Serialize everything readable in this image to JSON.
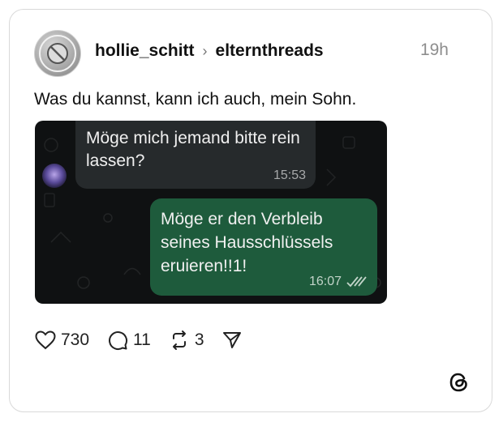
{
  "post": {
    "username": "hollie_schitt",
    "community": "elternthreads",
    "time": "19h",
    "caption": "Was du kannst, kann ich auch, mein Sohn."
  },
  "chat": {
    "incoming": {
      "text": "Möge mich jemand bitte rein lassen?",
      "time": "15:53"
    },
    "outgoing": {
      "text": "Möge er den Verbleib seines Hausschlüssels eruieren!!1!",
      "time": "16:07"
    }
  },
  "actions": {
    "likes": "730",
    "replies": "11",
    "reposts": "3"
  },
  "icons": {
    "like": "heart-icon",
    "reply": "comment-icon",
    "repost": "repost-icon",
    "share": "send-icon",
    "brand": "threads-logo-icon"
  },
  "colors": {
    "outgoing_bubble": "#1e5b3c",
    "incoming_bubble": "#262a2c",
    "chat_background": "#0f1112"
  }
}
